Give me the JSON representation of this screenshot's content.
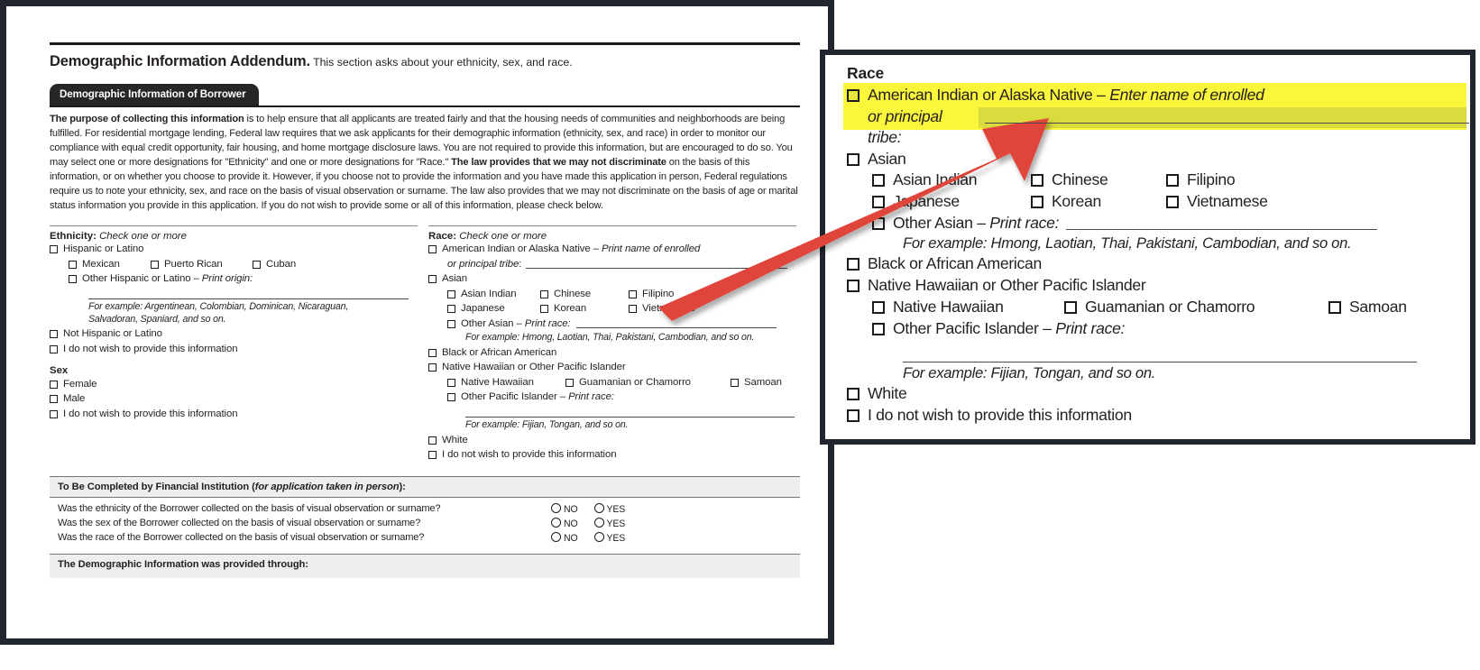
{
  "document": {
    "title_bold": "Demographic Information Addendum.",
    "title_rest": " This section asks about your ethnicity, sex, and race.",
    "section_tab": "Demographic Information of Borrower",
    "paragraph_lead": "The purpose of collecting this information",
    "paragraph_body_1": " is to help ensure that all applicants are treated fairly and that the housing needs of communities and neighborhoods are being fulfilled. For residential mortgage lending, Federal law requires that we ask applicants for their demographic information (ethnicity, sex, and race) in order to monitor our compliance with equal credit opportunity, fair housing, and home mortgage disclosure laws. You are not required to provide this information, but are encouraged to do so. You may select one or more designations for \"Ethnicity\" and one or more designations for \"Race.\" ",
    "paragraph_bold_2": "The law provides that we may not discriminate",
    "paragraph_body_2": " on the basis of this information, or on whether you choose to provide it. However, if you choose not to provide the information and you have made this application in person, Federal regulations require us to note your ethnicity, sex, and race on the basis of visual observation or surname. The law also provides that we may not discriminate on the basis of age or marital status information you provide in this application.  If you do not wish to provide some or all of this information, please check below.",
    "ethnicity": {
      "heading_bold": "Ethnicity:",
      "heading_italic": " Check one or more",
      "items": [
        "Hispanic or Latino",
        "Mexican",
        "Puerto Rican",
        "Cuban",
        "Other Hispanic or Latino",
        "Not Hispanic or Latino",
        "I do not wish to provide this information"
      ],
      "other_hint": " – Print origin:",
      "example_line1": "For example: Argentinean, Colombian,  Dominican, Nicaraguan,",
      "example_line2": "Salvadoran, Spaniard, and so on."
    },
    "sex": {
      "heading": "Sex",
      "items": [
        "Female",
        "Male",
        "I do not wish to provide this information"
      ]
    },
    "race": {
      "heading_bold": "Race:",
      "heading_italic": " Check one or more",
      "aian_label": "American Indian or Alaska Native – ",
      "aian_hint": "Print name of enrolled",
      "aian_line2_italic": "or principal tribe",
      "aian_line2_colon": ":",
      "asian": "Asian",
      "asian_sub": [
        "Asian Indian",
        "Chinese",
        "Filipino",
        "Japanese",
        "Korean",
        "Vietnamese"
      ],
      "other_asian": "Other Asian – ",
      "other_asian_hint": "Print race:",
      "asian_example": "For example: Hmong, Laotian, Thai, Pakistani, Cambodian, and so on.",
      "black": "Black or African American",
      "nhopi": "Native Hawaiian or Other Pacific Islander",
      "nhopi_sub": [
        "Native Hawaiian",
        "Guamanian or Chamorro",
        "Samoan"
      ],
      "other_pi": "Other Pacific Islander – ",
      "other_pi_hint": "Print race:",
      "pi_example": "For example: Fijian, Tongan, and so on.",
      "white": "White",
      "decline": "I do not wish to provide this information"
    },
    "institution": {
      "heading_bold": "To Be Completed by Financial Institution (",
      "heading_italic": "for application taken in person",
      "heading_close": "):",
      "questions": [
        "Was the ethnicity of the Borrower collected on the basis of visual observation or surname?",
        "Was the sex of the Borrower collected on the basis of visual observation or surname?",
        "Was the race of the Borrower collected on the basis of visual observation or surname?"
      ],
      "option_no": "NO",
      "option_yes": "YES",
      "footer_heading": "The Demographic Information was provided through:"
    }
  },
  "callout": {
    "heading": "Race",
    "aian_label": "American Indian or Alaska Native – ",
    "aian_hint": "Enter name of enrolled",
    "aian_line2": "or principal tribe:",
    "asian": "Asian",
    "asian_sub": [
      "Asian Indian",
      "Chinese",
      "Filipino",
      "Japanese",
      "Korean",
      "Vietnamese"
    ],
    "other_asian": "Other Asian – ",
    "other_asian_hint": "Print race:",
    "asian_example": "For example: Hmong, Laotian, Thai, Pakistani, Cambodian, and so on.",
    "black": "Black or African American",
    "nhopi": "Native Hawaiian or Other Pacific Islander",
    "nhopi_sub": [
      "Native Hawaiian",
      "Guamanian or Chamorro",
      "Samoan"
    ],
    "other_pi": "Other Pacific Islander – ",
    "other_pi_hint": "Print race:",
    "pi_example": "For example: Fijian, Tongan, and so on.",
    "white": "White",
    "decline": "I do not wish to provide this information"
  },
  "colors": {
    "frame": "#21252e",
    "highlight": "#faf63c",
    "highlight_band": "#d9dc3c",
    "arrow": "#e0443a",
    "graybar": "#eeeeee"
  }
}
